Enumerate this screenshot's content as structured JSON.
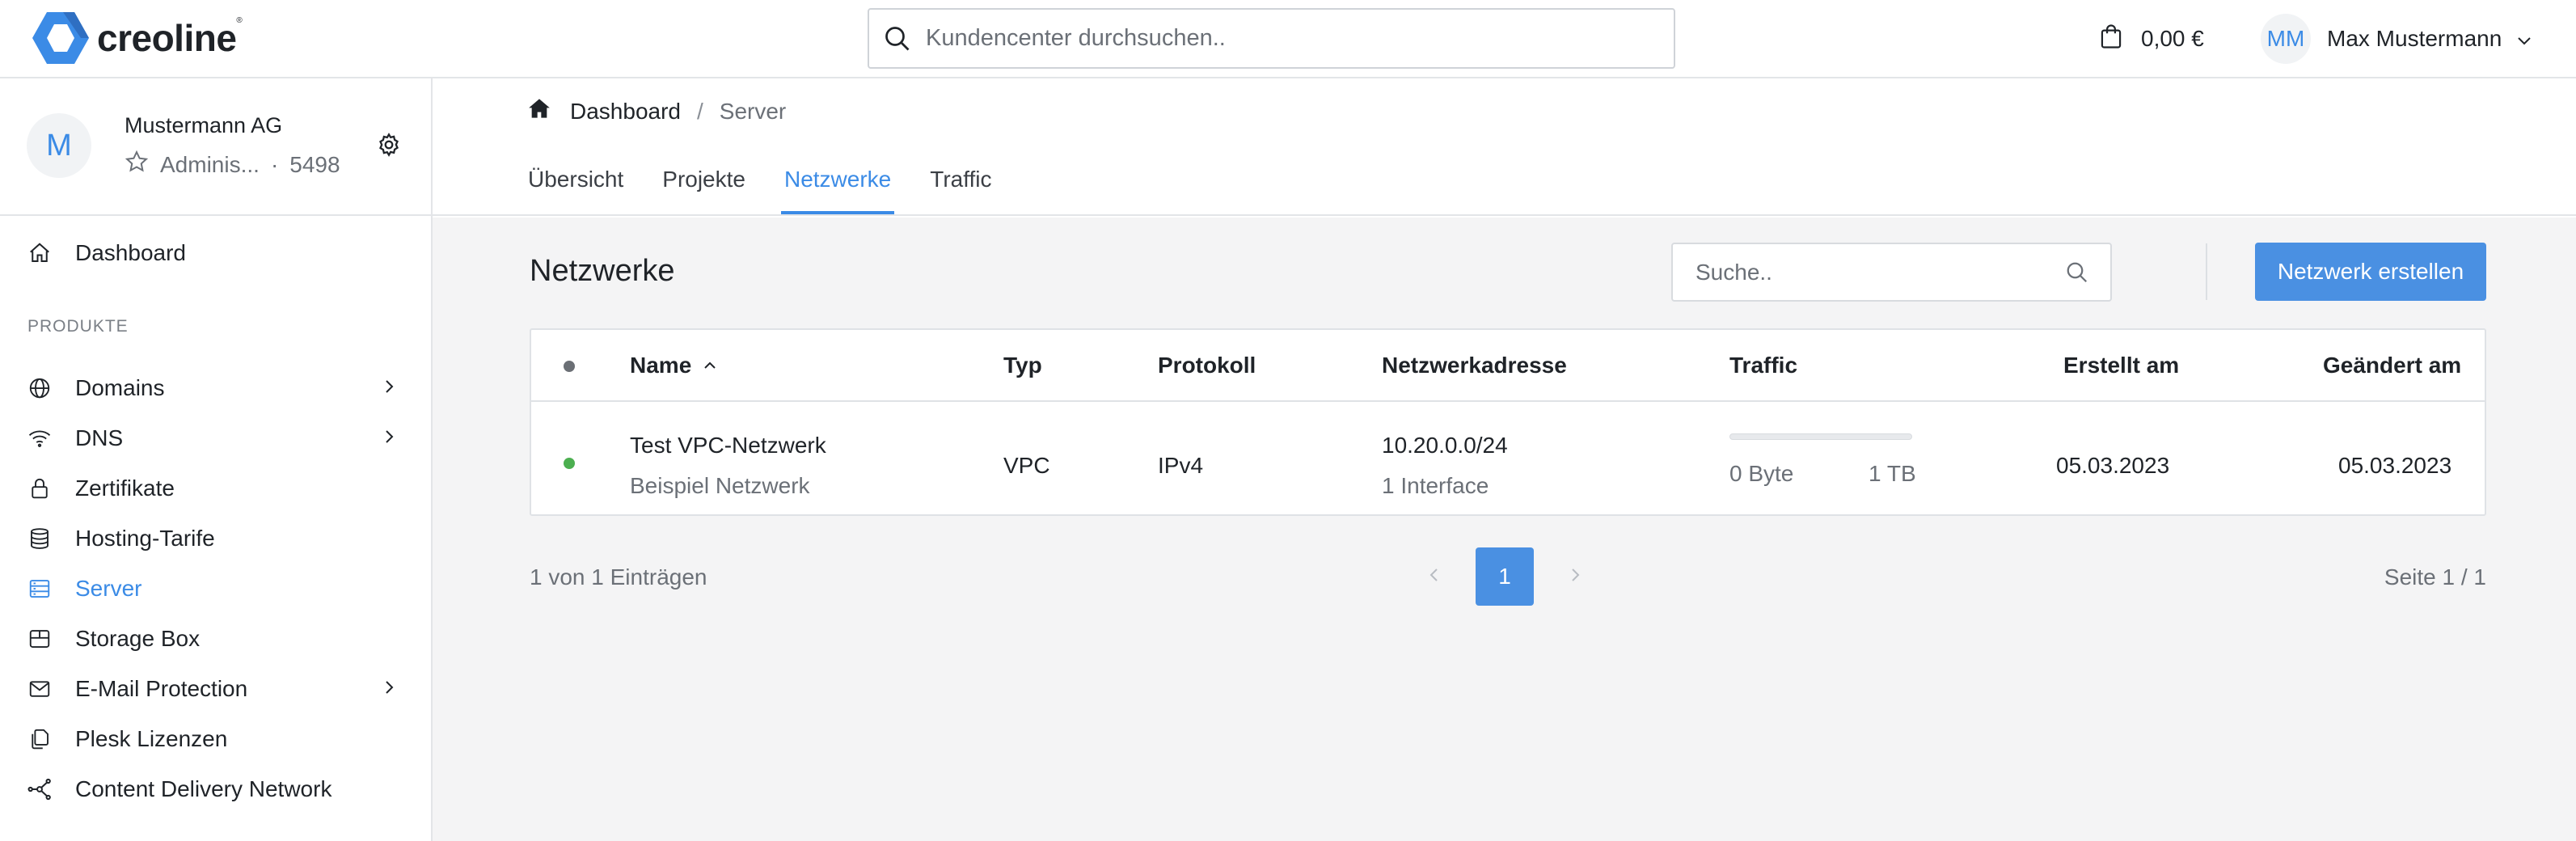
{
  "brand": {
    "name": "creoline",
    "trademark": "®",
    "accent": "#3b8be6"
  },
  "topbar": {
    "search_placeholder": "Kundencenter durchsuchen..",
    "cart_amount": "0,00 €",
    "user_initials": "MM",
    "user_name": "Max Mustermann"
  },
  "account": {
    "initial": "M",
    "name": "Mustermann AG",
    "role": "Adminis...",
    "separator": "·",
    "customer_id": "5498"
  },
  "sidebar": {
    "dashboard": "Dashboard",
    "section": "PRODUKTE",
    "items": [
      {
        "label": "Domains",
        "icon": "globe-icon",
        "expandable": true
      },
      {
        "label": "DNS",
        "icon": "wifi-icon",
        "expandable": true
      },
      {
        "label": "Zertifikate",
        "icon": "lock-icon",
        "expandable": false
      },
      {
        "label": "Hosting-Tarife",
        "icon": "database-icon",
        "expandable": false
      },
      {
        "label": "Server",
        "icon": "server-icon",
        "expandable": false,
        "active": true
      },
      {
        "label": "Storage Box",
        "icon": "box-icon",
        "expandable": false
      },
      {
        "label": "E-Mail Protection",
        "icon": "mail-icon",
        "expandable": true
      },
      {
        "label": "Plesk Lizenzen",
        "icon": "license-icon",
        "expandable": false
      },
      {
        "label": "Content Delivery Network",
        "icon": "network-icon",
        "expandable": false
      }
    ]
  },
  "breadcrumb": {
    "home": "Dashboard",
    "separator": "/",
    "current": "Server"
  },
  "tabs": [
    {
      "label": "Übersicht"
    },
    {
      "label": "Projekte"
    },
    {
      "label": "Netzwerke",
      "active": true
    },
    {
      "label": "Traffic"
    }
  ],
  "page": {
    "title": "Netzwerke",
    "search_placeholder": "Suche..",
    "create_button": "Netzwerk erstellen"
  },
  "table": {
    "columns": {
      "name": "Name",
      "type": "Typ",
      "protocol": "Protokoll",
      "address": "Netzwerkadresse",
      "traffic": "Traffic",
      "created": "Erstellt am",
      "changed": "Geändert am"
    },
    "rows": [
      {
        "status_color": "#4caf50",
        "name": "Test VPC-Netzwerk",
        "description": "Beispiel Netzwerk",
        "type": "VPC",
        "protocol": "IPv4",
        "address": "10.20.0.0/24",
        "interfaces": "1 Interface",
        "traffic_used": "0 Byte",
        "traffic_limit": "1 TB",
        "traffic_fraction": 0,
        "created": "05.03.2023",
        "changed": "05.03.2023"
      }
    ]
  },
  "pagination": {
    "info": "1 von 1 Einträgen",
    "current_page": "1",
    "page_of": "Seite 1 / 1"
  }
}
